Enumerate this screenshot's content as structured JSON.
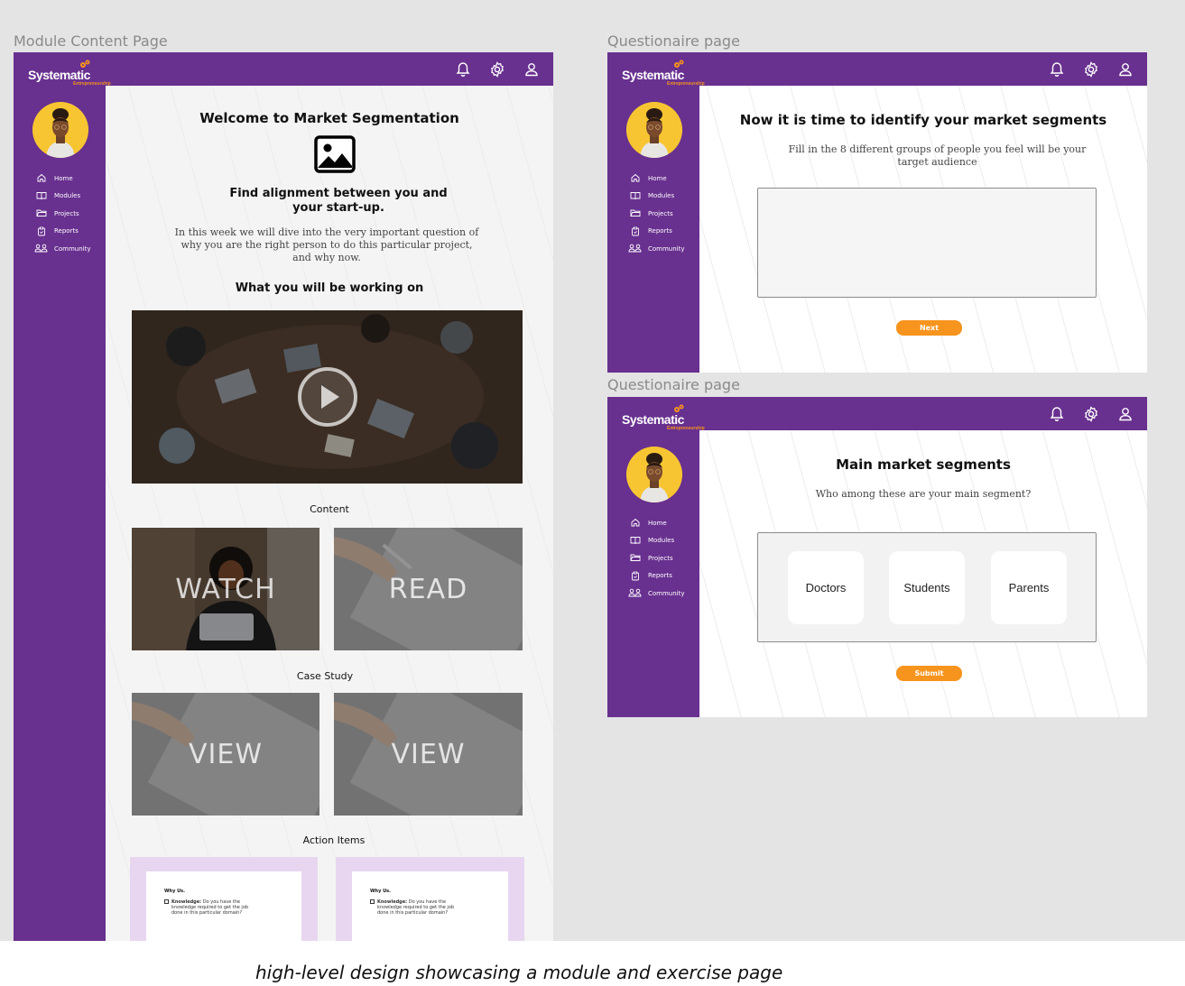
{
  "frames": {
    "module": {
      "label": "Module Content Page"
    },
    "q1": {
      "label": "Questionaire page"
    },
    "q2": {
      "label": "Questionaire page"
    }
  },
  "brand": {
    "name": "Systematic",
    "tagline": "Entrepreneurship",
    "accent": "#68308f",
    "orange": "#f7941d"
  },
  "nav": [
    "Home",
    "Modules",
    "Projects",
    "Reports",
    "Community"
  ],
  "module": {
    "title": "Welcome to Market Segmentation",
    "subtitle": "Find alignment between you and your start-up.",
    "intro": "In this week we will dive into the very important question of why you are the right person to do this particular project, and why now.",
    "working_on": "What you will be working on",
    "content_label": "Content",
    "watch_label": "WATCH",
    "read_label": "READ",
    "case_study_label": "Case Study",
    "view_label_1": "VIEW",
    "view_label_2": "VIEW",
    "action_items_label": "Action Items",
    "action_cards": [
      {
        "title": "Why Us.",
        "item_bold": "Knowledge:",
        "item_text": " Do you have the knowledge required to get the job done in this particular domain?"
      },
      {
        "title": "Why Us.",
        "item_bold": "Knowledge:",
        "item_text": " Do you have the knowledge required to get the job done in this particular domain?"
      }
    ]
  },
  "q1": {
    "title": "Now it is time to identify your market segments",
    "prompt": "Fill in the 8 different groups of people you feel will be your target audience",
    "next_label": "Next"
  },
  "q2": {
    "title": "Main market segments",
    "prompt": "Who among these are your main segment?",
    "options": [
      "Doctors",
      "Students",
      "Parents"
    ],
    "submit_label": "Submit"
  },
  "caption": "high-level design showcasing a module and exercise page"
}
